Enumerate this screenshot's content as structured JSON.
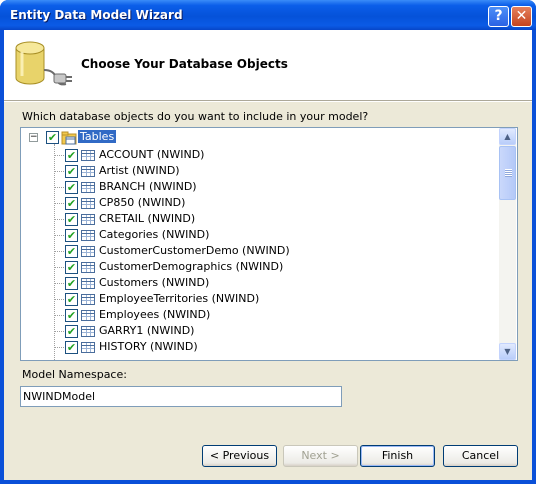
{
  "window": {
    "title": "Entity Data Model Wizard"
  },
  "header": {
    "heading": "Choose Your Database Objects"
  },
  "question": "Which database objects do you want to include in your model?",
  "tree": {
    "root_label": "Tables",
    "items": [
      {
        "label": "ACCOUNT (NWIND)"
      },
      {
        "label": "Artist (NWIND)"
      },
      {
        "label": "BRANCH (NWIND)"
      },
      {
        "label": "CP850 (NWIND)"
      },
      {
        "label": "CRETAIL (NWIND)"
      },
      {
        "label": "Categories (NWIND)"
      },
      {
        "label": "CustomerCustomerDemo (NWIND)"
      },
      {
        "label": "CustomerDemographics (NWIND)"
      },
      {
        "label": "Customers (NWIND)"
      },
      {
        "label": "EmployeeTerritories (NWIND)"
      },
      {
        "label": "Employees (NWIND)"
      },
      {
        "label": "GARRY1 (NWIND)"
      },
      {
        "label": "HISTORY (NWIND)"
      }
    ]
  },
  "namespace": {
    "label": "Model Namespace:",
    "value": "NWINDModel"
  },
  "buttons": {
    "previous": "< Previous",
    "next": "Next >",
    "finish": "Finish",
    "cancel": "Cancel"
  },
  "icons": {
    "help": "help-icon",
    "close": "close-icon",
    "database": "database-plug-icon",
    "table": "table-icon"
  }
}
